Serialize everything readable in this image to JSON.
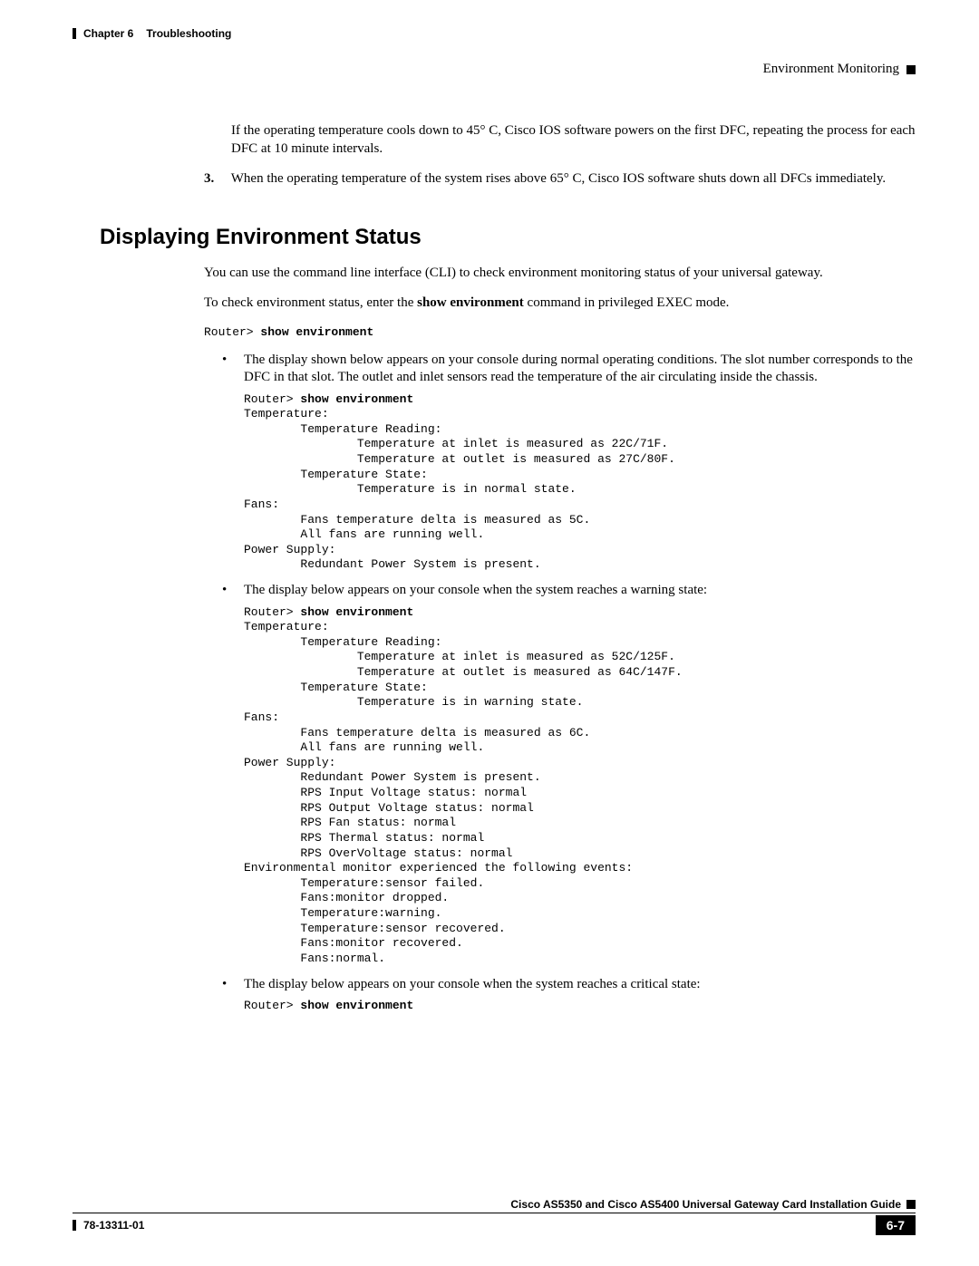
{
  "header": {
    "chapter_label": "Chapter 6",
    "chapter_title": "Troubleshooting",
    "section_title": "Environment Monitoring"
  },
  "body": {
    "p1": "If the operating temperature cools down to 45° C, Cisco IOS software powers on the first DFC, repeating the process for each DFC at 10 minute intervals.",
    "step3_num": "3.",
    "step3_text": "When the operating temperature of the system rises above 65° C, Cisco IOS software shuts down all DFCs immediately."
  },
  "heading": "Displaying Environment Status",
  "intro1": "You can use the command line interface (CLI) to check environment monitoring status of your universal gateway.",
  "intro2_pre": "To check environment status, enter the ",
  "intro2_cmd": "show environment",
  "intro2_post": " command in privileged EXEC mode.",
  "prompt_prefix": "Router> ",
  "prompt_cmd": "show environment",
  "bullets": {
    "b1_text": "The display shown below appears on your console during normal operating conditions. The slot number corresponds to the DFC in that slot. The outlet and inlet sensors read the temperature of the air circulating inside the chassis.",
    "b1_code": "Router> show environment\nTemperature:\n        Temperature Reading:\n                Temperature at inlet is measured as 22C/71F.\n                Temperature at outlet is measured as 27C/80F.\n        Temperature State:\n                Temperature is in normal state.\nFans:\n        Fans temperature delta is measured as 5C.\n        All fans are running well.\nPower Supply:\n        Redundant Power System is present.",
    "b2_text": "The display below appears on your console when the system reaches a warning state:",
    "b2_code": "Router> show environment\nTemperature:\n        Temperature Reading:\n                Temperature at inlet is measured as 52C/125F.\n                Temperature at outlet is measured as 64C/147F.\n        Temperature State:\n                Temperature is in warning state.\nFans:\n        Fans temperature delta is measured as 6C.\n        All fans are running well.\nPower Supply:\n        Redundant Power System is present.\n        RPS Input Voltage status: normal\n        RPS Output Voltage status: normal\n        RPS Fan status: normal\n        RPS Thermal status: normal\n        RPS OverVoltage status: normal\nEnvironmental monitor experienced the following events:\n        Temperature:sensor failed.\n        Fans:monitor dropped.\n        Temperature:warning.\n        Temperature:sensor recovered.\n        Fans:monitor recovered.\n        Fans:normal.",
    "b3_text": "The display below appears on your console when the system reaches a critical state:",
    "b3_code": "Router> show environment"
  },
  "footer": {
    "guide_title": "Cisco AS5350 and Cisco AS5400 Universal Gateway Card Installation Guide",
    "doc_number": "78-13311-01",
    "page_number": "6-7"
  }
}
